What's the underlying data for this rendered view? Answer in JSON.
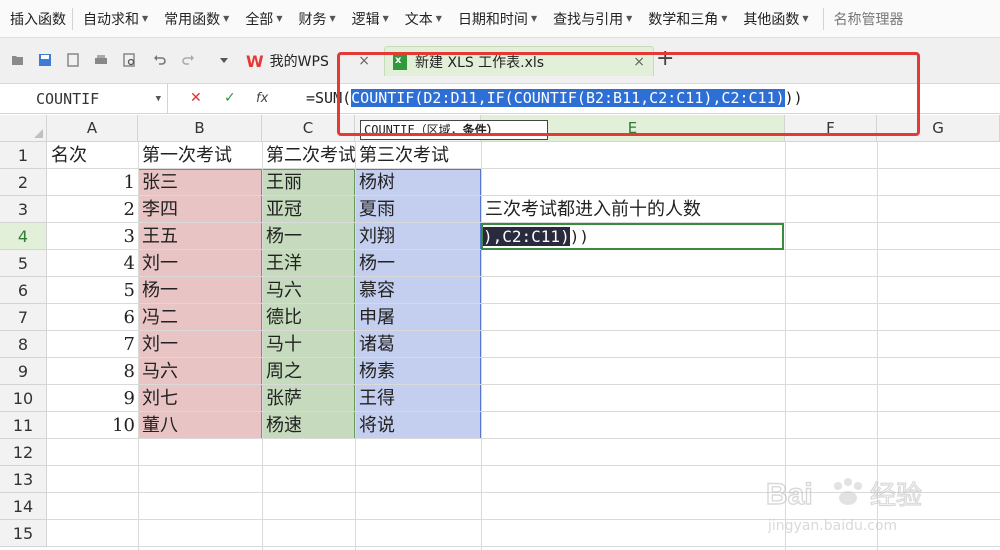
{
  "ribbon": {
    "items": [
      {
        "label": "插入函数",
        "caret": false
      },
      {
        "label": "自动求和",
        "caret": true
      },
      {
        "label": "常用函数",
        "caret": true
      },
      {
        "label": "全部",
        "caret": true
      },
      {
        "label": "财务",
        "caret": true
      },
      {
        "label": "逻辑",
        "caret": true
      },
      {
        "label": "文本",
        "caret": true
      },
      {
        "label": "日期和时间",
        "caret": true
      },
      {
        "label": "查找与引用",
        "caret": true
      },
      {
        "label": "数学和三角",
        "caret": true
      },
      {
        "label": "其他函数",
        "caret": true
      }
    ],
    "name_manager": "名称管理器"
  },
  "tabs": {
    "wps": "我的WPS",
    "file": "新建 XLS 工作表.xls",
    "close": "×",
    "add": "+"
  },
  "formula_bar": {
    "name_box": "COUNTIF",
    "cancel": "✕",
    "confirm": "✓",
    "fx": "fx",
    "prefix": "=SUM(",
    "highlighted": "COUNTIF(D2:D11,IF(COUNTIF(B2:B11,C2:C11),C2:C11)",
    "suffix": "))"
  },
  "tooltip": {
    "func": "COUNTIF",
    "args": "（区域，",
    "bold_arg": "条件）"
  },
  "columns": [
    "A",
    "B",
    "C",
    "D",
    "E",
    "F",
    "G"
  ],
  "active_column": "E",
  "rows": [
    "1",
    "2",
    "3",
    "4",
    "5",
    "6",
    "7",
    "8",
    "9",
    "10",
    "11",
    "12",
    "13",
    "14",
    "15"
  ],
  "active_row": "4",
  "headers": {
    "a": "名次",
    "b": "第一次考试",
    "c": "第二次考试",
    "d": "第三次考试"
  },
  "data_rows": [
    {
      "rank": "1",
      "b": "张三",
      "c": "王丽",
      "d": "杨树"
    },
    {
      "rank": "2",
      "b": "李四",
      "c": "亚冠",
      "d": "夏雨"
    },
    {
      "rank": "3",
      "b": "王五",
      "c": "杨一",
      "d": "刘翔"
    },
    {
      "rank": "4",
      "b": "刘一",
      "c": "王洋",
      "d": "杨一"
    },
    {
      "rank": "5",
      "b": "杨一",
      "c": "马六",
      "d": "慕容"
    },
    {
      "rank": "6",
      "b": "冯二",
      "c": "德比",
      "d": "申屠"
    },
    {
      "rank": "7",
      "b": "刘一",
      "c": "马十",
      "d": "诸葛"
    },
    {
      "rank": "8",
      "b": "马六",
      "c": "周之",
      "d": "杨素"
    },
    {
      "rank": "9",
      "b": "刘七",
      "c": "张萨",
      "d": "王得"
    },
    {
      "rank": "10",
      "b": "董八",
      "c": "杨速",
      "d": "将说"
    }
  ],
  "e3_text": "三次考试都进入前十的人数",
  "e4_edit": {
    "highlighted": "),C2:C11)",
    "rest": "))"
  },
  "range_colors": {
    "b": "#e8c4c4",
    "c": "#c6dbbd",
    "d": "#c4cff0",
    "b_border": "#d06666",
    "c_border": "#6b9b5a",
    "d_border": "#5577d0"
  },
  "watermark": {
    "brand": "Bai",
    "brand_cn": "经验",
    "url": "jingyan.baidu.com"
  }
}
